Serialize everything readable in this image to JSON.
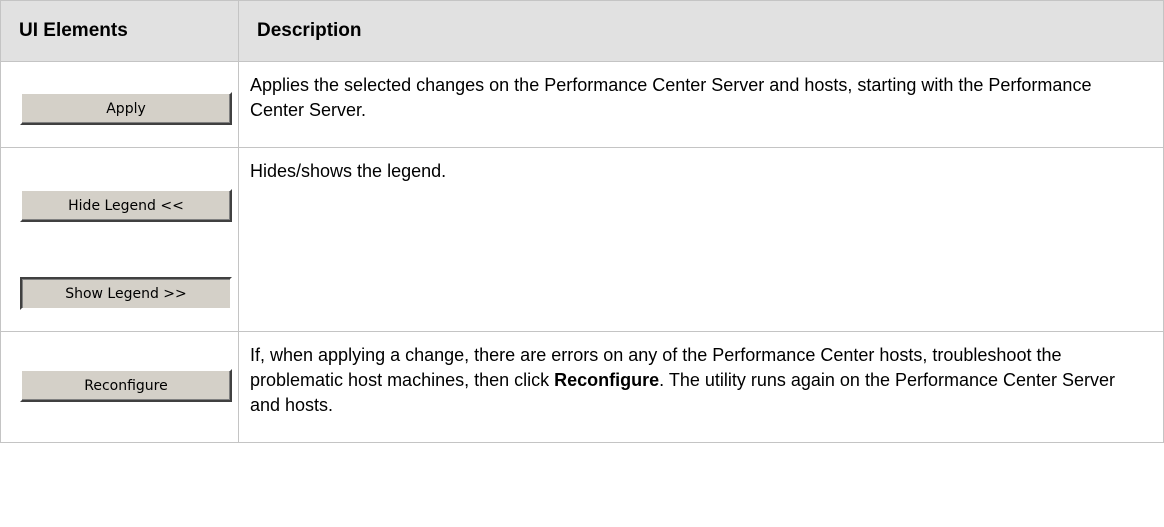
{
  "table": {
    "headers": [
      "UI Elements",
      "Description"
    ],
    "rows": [
      {
        "buttons": [
          "Apply"
        ],
        "description": "Applies the selected changes on the Performance Center Server and hosts, starting with the Performance Center Server."
      },
      {
        "buttons": [
          "Hide Legend  <<",
          "Show Legend >>"
        ],
        "description": "Hides/shows the legend."
      },
      {
        "buttons": [
          "Reconfigure"
        ],
        "description_before": "If, when applying a change, there are errors on any of the Performance Center hosts, troubleshoot the problematic host machines, then click ",
        "description_bold": "Reconfigure",
        "description_after": ". The utility runs again on the Performance Center Server and hosts."
      }
    ]
  }
}
